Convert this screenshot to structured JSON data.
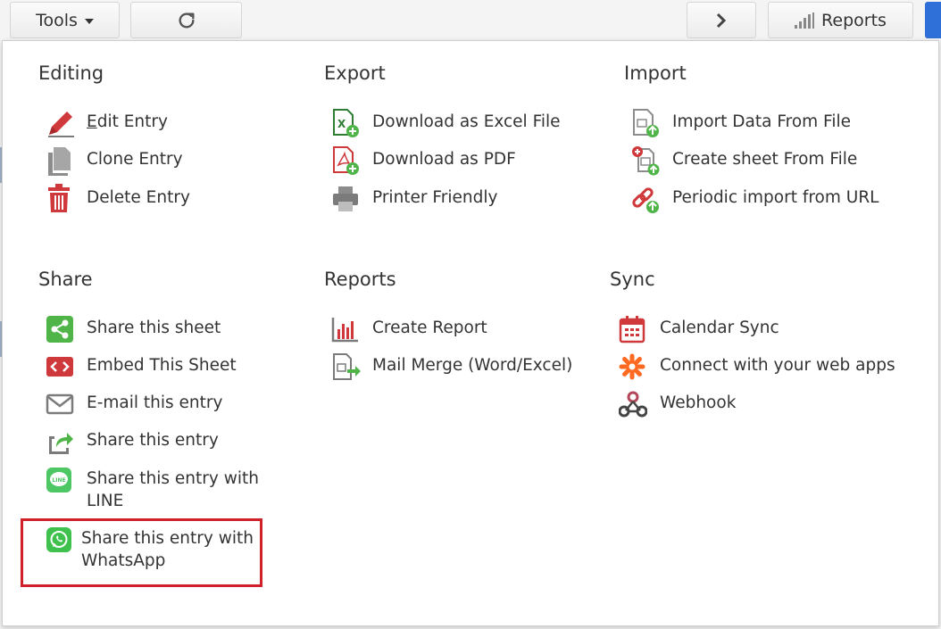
{
  "toolbar": {
    "tools_label": "Tools",
    "reports_label": "Reports"
  },
  "sections": {
    "editing": {
      "title": "Editing",
      "items": [
        {
          "label_first": "E",
          "label_rest": "dit Entry",
          "icon": "pencil-icon"
        },
        {
          "label": "Clone Entry",
          "icon": "copy-icon"
        },
        {
          "label": "Delete Entry",
          "icon": "trash-icon"
        }
      ]
    },
    "export": {
      "title": "Export",
      "items": [
        {
          "label": "Download as Excel File",
          "icon": "excel-file-icon"
        },
        {
          "label": "Download as PDF",
          "icon": "pdf-file-icon"
        },
        {
          "label": "Printer Friendly",
          "icon": "printer-icon"
        }
      ]
    },
    "import": {
      "title": "Import",
      "items": [
        {
          "label": "Import Data From File",
          "icon": "import-file-icon"
        },
        {
          "label": "Create sheet From File",
          "icon": "create-sheet-icon"
        },
        {
          "label": "Periodic import from URL",
          "icon": "link-icon"
        }
      ]
    },
    "share": {
      "title": "Share",
      "items": [
        {
          "label": "Share this sheet",
          "icon": "share-icon"
        },
        {
          "label": "Embed This Sheet",
          "icon": "embed-icon"
        },
        {
          "label": "E-mail this entry",
          "icon": "email-icon"
        },
        {
          "label": "Share this entry",
          "icon": "share-arrow-icon"
        },
        {
          "label": "Share this entry with LINE",
          "icon": "line-icon"
        },
        {
          "label": "Share this entry with WhatsApp",
          "icon": "whatsapp-icon"
        }
      ]
    },
    "reports": {
      "title": "Reports",
      "items": [
        {
          "label": "Create Report",
          "icon": "bar-chart-icon"
        },
        {
          "label": "Mail Merge (Word/Excel)",
          "icon": "mail-merge-icon"
        }
      ]
    },
    "sync": {
      "title": "Sync",
      "items": [
        {
          "label": "Calendar Sync",
          "icon": "calendar-icon"
        },
        {
          "label": "Connect with your web apps",
          "icon": "zapier-icon"
        },
        {
          "label": "Webhook",
          "icon": "webhook-icon"
        }
      ]
    }
  },
  "colors": {
    "highlight": "#d0202a",
    "green": "#4fb548",
    "red": "#d0393b",
    "gray": "#7b7b7b"
  }
}
